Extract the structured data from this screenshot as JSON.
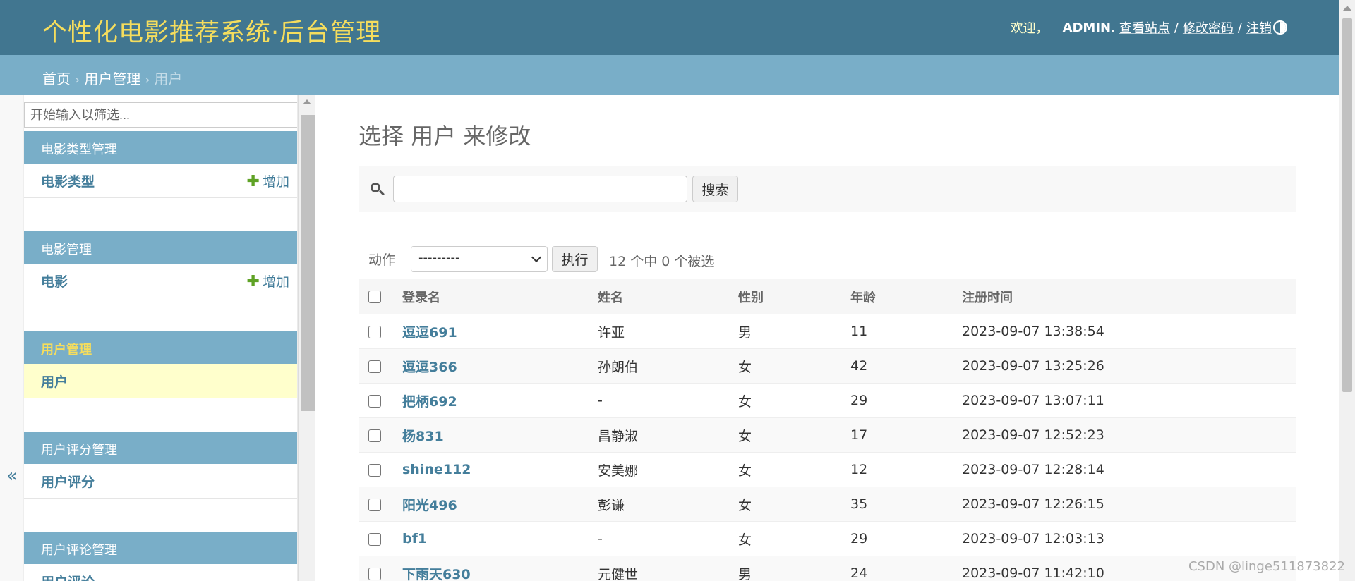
{
  "header": {
    "site_title": "个性化电影推荐系统·后台管理",
    "welcome": "欢迎，",
    "username": "ADMIN",
    "dot": ".",
    "view_site": "查看站点",
    "change_password": "修改密码",
    "logout": "注销",
    "sep": "/",
    "theme_icon": "half-circle-icon"
  },
  "breadcrumbs": {
    "home": "首页",
    "app": "用户管理",
    "current": "用户",
    "arrow": "›"
  },
  "sidebar": {
    "toggle": "«",
    "filter_placeholder": "开始输入以筛选...",
    "modules": [
      {
        "caption": "电影类型管理",
        "model": "电影类型",
        "add": "增加"
      },
      {
        "caption": "电影管理",
        "model": "电影",
        "add": "增加"
      },
      {
        "caption": "用户管理",
        "model": "用户",
        "add": ""
      },
      {
        "caption": "用户评分管理",
        "model": "用户评分",
        "add": ""
      },
      {
        "caption": "用户评论管理",
        "model": "用户评论",
        "add": ""
      }
    ],
    "plus": "✚"
  },
  "main": {
    "title": "选择 用户 来修改",
    "search_button": "搜索",
    "action_label": "动作",
    "action_value": "---------",
    "go_button": "执行",
    "counter": "12 个中 0 个被选",
    "columns": [
      "登录名",
      "姓名",
      "性别",
      "年龄",
      "注册时间"
    ],
    "rows": [
      {
        "login": "逗逗691",
        "name": "许亚",
        "gender": "男",
        "age": "11",
        "time": "2023-09-07 13:38:54"
      },
      {
        "login": "逗逗366",
        "name": "孙朗伯",
        "gender": "女",
        "age": "42",
        "time": "2023-09-07 13:25:26"
      },
      {
        "login": "把柄692",
        "name": "-",
        "gender": "女",
        "age": "29",
        "time": "2023-09-07 13:07:11"
      },
      {
        "login": "杨831",
        "name": "昌静淑",
        "gender": "女",
        "age": "17",
        "time": "2023-09-07 12:52:23"
      },
      {
        "login": "shine112",
        "name": "安美娜",
        "gender": "女",
        "age": "12",
        "time": "2023-09-07 12:28:14"
      },
      {
        "login": "阳光496",
        "name": "彭谦",
        "gender": "女",
        "age": "35",
        "time": "2023-09-07 12:26:15"
      },
      {
        "login": "bf1",
        "name": "-",
        "gender": "女",
        "age": "29",
        "time": "2023-09-07 12:03:13"
      },
      {
        "login": "下雨天630",
        "name": "元健世",
        "gender": "男",
        "age": "24",
        "time": "2023-09-07 11:42:10"
      }
    ]
  },
  "watermark": "CSDN @linge511873822",
  "colors": {
    "header_bg": "#417690",
    "breadcrumb_bg": "#79aec8",
    "accent_yellow": "#f5dd5d",
    "link": "#447e9b",
    "add_green": "#5fa225",
    "selected_row": "#ffffcc"
  }
}
